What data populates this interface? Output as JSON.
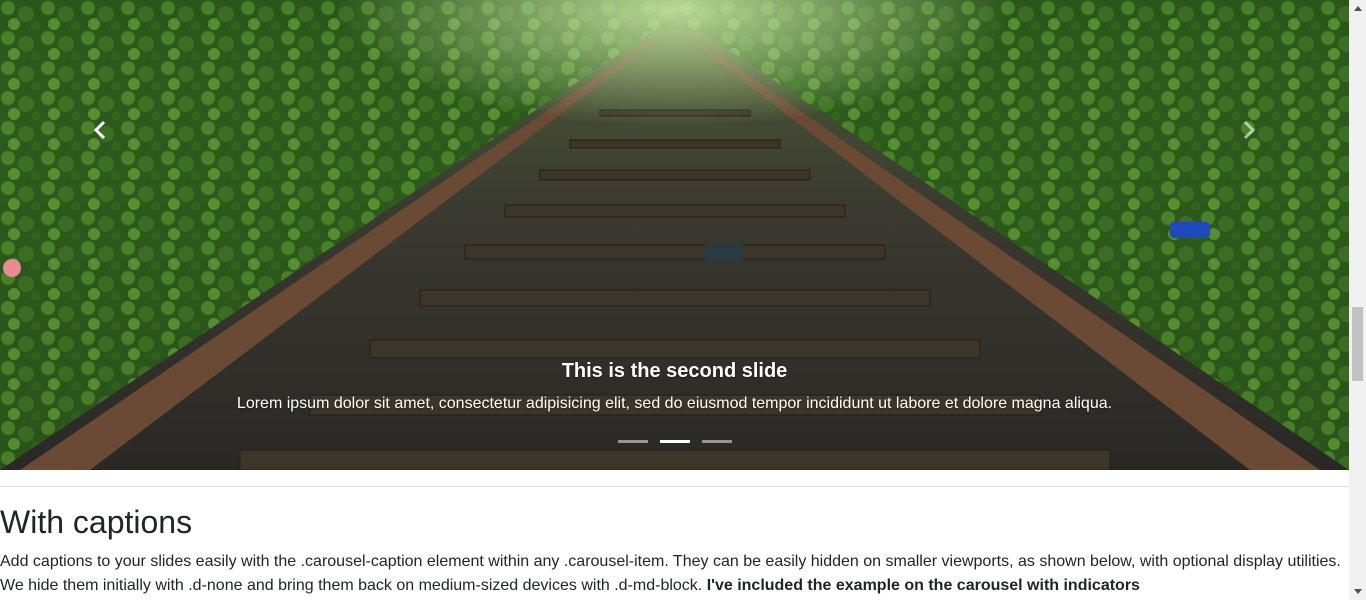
{
  "carousel": {
    "active_index": 1,
    "slide_count": 3,
    "caption_title": "This is the second slide",
    "caption_text": "Lorem ipsum dolor sit amet, consectetur adipisicing elit, sed do eiusmod tempor incididunt ut labore et dolore magna aliqua.",
    "prev_icon": "chevron-left-icon",
    "next_icon": "chevron-right-icon",
    "image_subject": "railway-track"
  },
  "section": {
    "title": "With captions",
    "text": "Add captions to your slides easily with the .carousel-caption element within any .carousel-item. They can be easily hidden on smaller viewports, as shown below, with optional display utilities. We hide them initially with .d-none and bring them back on medium-sized devices with .d-md-block.",
    "text_bold": "I've included the example on the carousel with indicators"
  },
  "colors": {
    "text": "#212529",
    "divider": "#dee2e6",
    "scrollbar_track": "#f1f1f1",
    "scrollbar_thumb": "#c1c1c1"
  }
}
